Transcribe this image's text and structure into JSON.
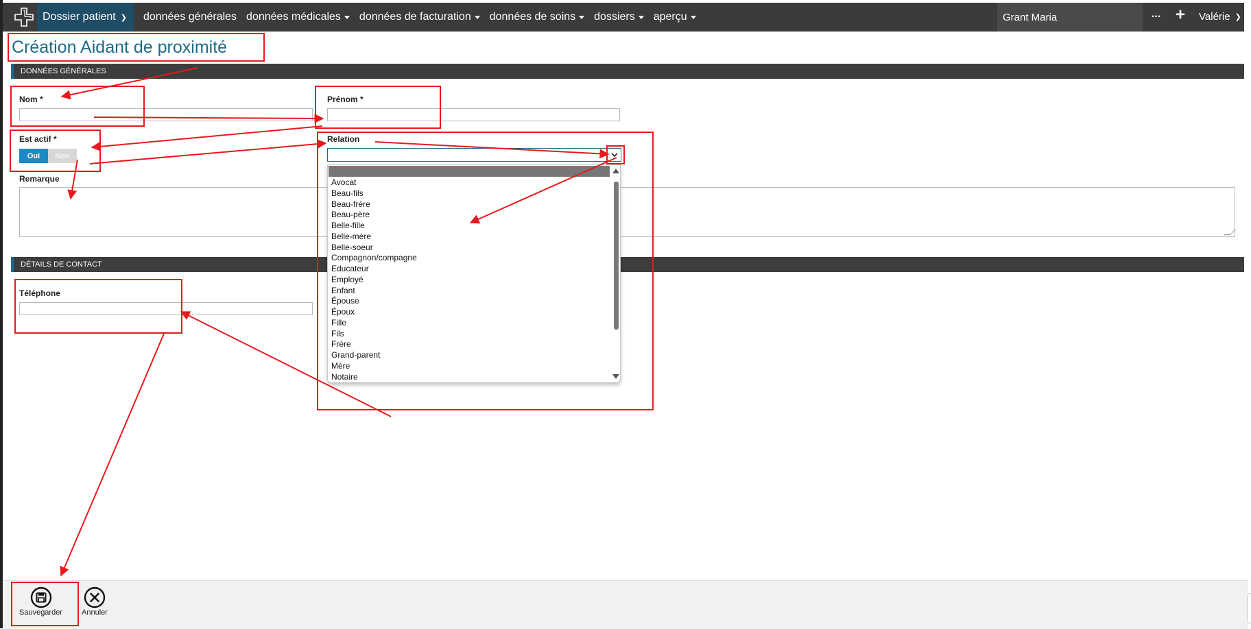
{
  "nav": {
    "active_item": "Dossier patient",
    "items": [
      "données générales",
      "données médicales",
      "données de facturation",
      "données de soins",
      "dossiers",
      "aperçu"
    ],
    "patient": "Grant Maria",
    "more": "...",
    "plus": "+",
    "user": "Valérie"
  },
  "page": {
    "title": "Création Aidant de proximité"
  },
  "general": {
    "section_title": "DONNÉES GÉNÉRALES",
    "nom_label": "Nom *",
    "prenom_label": "Prénom *",
    "est_actif_label": "Est actif *",
    "toggle_on": "Oui",
    "toggle_off": "Non",
    "relation_label": "Relation",
    "remarque_label": "Remarque"
  },
  "relation_options": [
    "Avocat",
    "Beau-fils",
    "Beau-frère",
    "Beau-père",
    "Belle-fille",
    "Belle-mère",
    "Belle-soeur",
    "Compagnon/compagne",
    "Educateur",
    "Employé",
    "Enfant",
    "Épouse",
    "Époux",
    "Fille",
    "Fils",
    "Frère",
    "Grand-parent",
    "Mère",
    "Notaire"
  ],
  "contact": {
    "section_title": "DÉTAILS DE CONTACT",
    "telephone_label": "Téléphone"
  },
  "actions": {
    "save": "Sauvegarder",
    "cancel": "Annuler"
  },
  "colors": {
    "nav_bg": "#3b3b3b",
    "accent": "#1d6a86",
    "toggle_on": "#1d8ac4",
    "annotation": "#e8191c"
  }
}
